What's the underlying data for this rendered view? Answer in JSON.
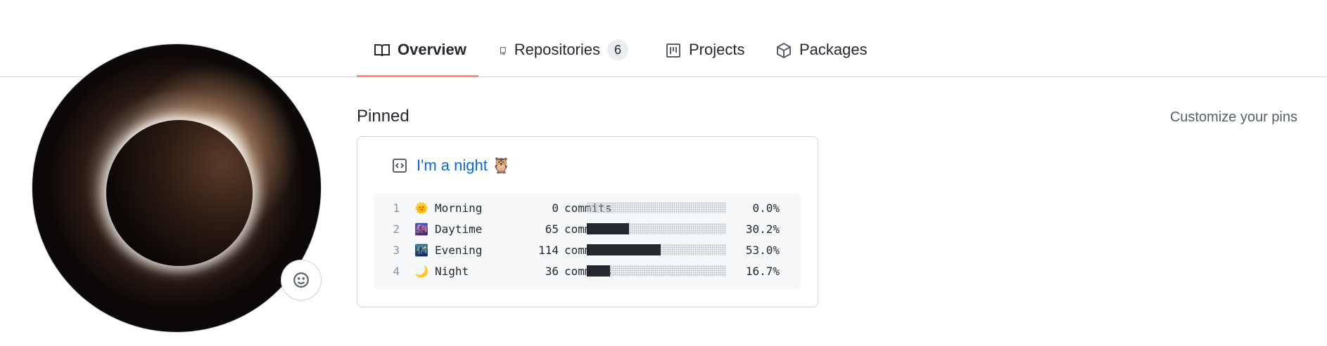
{
  "nav": {
    "tabs": [
      {
        "label": "Overview",
        "icon": "book-icon",
        "active": true
      },
      {
        "label": "Repositories",
        "icon": "repo-icon",
        "count": "6"
      },
      {
        "label": "Projects",
        "icon": "project-icon"
      },
      {
        "label": "Packages",
        "icon": "package-icon"
      }
    ]
  },
  "profile": {
    "avatar_icon": "eclipse-avatar",
    "status_icon": "smiley-icon"
  },
  "pinned": {
    "title": "Pinned",
    "customize_label": "Customize your pins",
    "card": {
      "repo_icon": "code-square-icon",
      "repo_name": "I'm a night 🦉",
      "stats": [
        {
          "line": "1",
          "emoji": "🌞",
          "name": "Morning",
          "count": "0",
          "unit": "commits",
          "fraction": 0.0,
          "percent": "0.0%"
        },
        {
          "line": "2",
          "emoji": "🌆",
          "name": "Daytime",
          "count": "65",
          "unit": "commits",
          "fraction": 0.302,
          "percent": "30.2%"
        },
        {
          "line": "3",
          "emoji": "🌃",
          "name": "Evening",
          "count": "114",
          "unit": "commits",
          "fraction": 0.53,
          "percent": "53.0%"
        },
        {
          "line": "4",
          "emoji": "🌙",
          "name": "Night",
          "count": "36",
          "unit": "commits",
          "fraction": 0.167,
          "percent": "16.7%"
        }
      ]
    }
  },
  "colors": {
    "accent_underline": "#fd8c73",
    "link": "#0969da",
    "bar_fill": "#24292f"
  }
}
